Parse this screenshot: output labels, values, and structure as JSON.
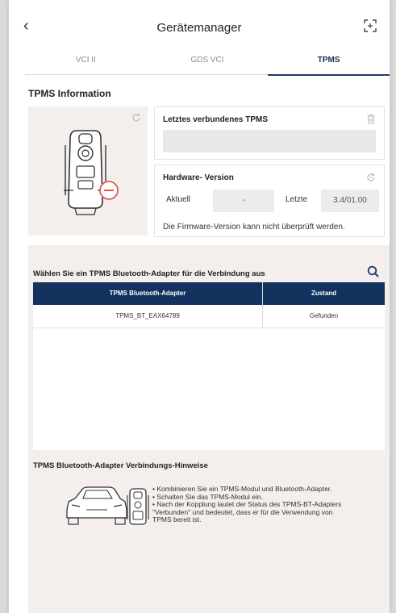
{
  "header": {
    "title": "Gerätemanager",
    "back_icon": "chevron-left-icon",
    "expand_icon": "expand-icon"
  },
  "tabs": [
    {
      "label": "VCI II",
      "active": false
    },
    {
      "label": "GDS VCI",
      "active": false
    },
    {
      "label": "TPMS",
      "active": true
    }
  ],
  "tpms_info": {
    "section_title": "TPMS Information",
    "last_connected": {
      "title": "Letztes verbundenes TPMS",
      "value": ""
    },
    "hardware": {
      "title": "Hardware- Version",
      "current_label": "Aktuell",
      "current_value": "-",
      "latest_label": "Letzte",
      "latest_value": "3.4/01.00",
      "note": "Die Firmware-Version kann nicht überprüft werden."
    }
  },
  "adapter": {
    "title": "Wählen Sie ein TPMS Bluetooth-Adapter für die Verbindung aus",
    "columns": [
      "TPMS Bluetooth-Adapter",
      "Zustand"
    ],
    "rows": [
      {
        "name": "TPMS_BT_EAX64789",
        "status": "Gefunden"
      }
    ]
  },
  "hints": {
    "title": "TPMS Bluetooth-Adapter Verbindungs-Hinweise",
    "items": [
      "• Kombinieren Sie ein TPMS-Modul und Bluetooth-Adapter.",
      "• Schalten Sie das TPMS-Modul ein.",
      "• Nach der Kopplung lautet der Status des TPMS-BT-Adapters",
      "\"Verbunden\" und bedeutet, dass er für die Verwendung von",
      "TPMS bereit ist."
    ]
  },
  "colors": {
    "accent": "#13325e",
    "panel_bg": "#f4efed",
    "warning_red": "#e05a4f"
  }
}
